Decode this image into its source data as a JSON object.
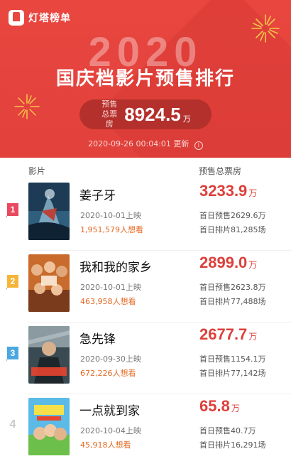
{
  "header": {
    "logo_text": "灯塔榜单",
    "year": "2020",
    "title": "国庆档影片预售排行",
    "presale_label": "预售 总票房",
    "presale_value": "8924.5",
    "presale_unit": "万",
    "update_text": "2020-09-26 00:04:01 更新",
    "info_icon": "i"
  },
  "columns": {
    "film": "影片",
    "presale": "预售总票房"
  },
  "colors": {
    "brand_red": "#e8463f",
    "gross_red": "#dd3f3a",
    "want_orange": "#e56a24",
    "rank1": "#e84a5f",
    "rank2": "#f4b63a",
    "rank3": "#4aa7e0"
  },
  "movies": [
    {
      "rank": "1",
      "title": "姜子牙",
      "release": "2020-10-01上映",
      "want": "1,951,579人想看",
      "gross": "3233.9",
      "gross_unit": "万",
      "first_day_presale": "首日预售2629.6万",
      "first_day_screenings": "首日排片81,285场"
    },
    {
      "rank": "2",
      "title": "我和我的家乡",
      "release": "2020-10-01上映",
      "want": "463,958人想看",
      "gross": "2899.0",
      "gross_unit": "万",
      "first_day_presale": "首日预售2623.8万",
      "first_day_screenings": "首日排片77,488场"
    },
    {
      "rank": "3",
      "title": "急先锋",
      "release": "2020-09-30上映",
      "want": "672,226人想看",
      "gross": "2677.7",
      "gross_unit": "万",
      "first_day_presale": "首日预售1154.1万",
      "first_day_screenings": "首日排片77,142场"
    },
    {
      "rank": "4",
      "title": "一点就到家",
      "release": "2020-10-04上映",
      "want": "45,918人想看",
      "gross": "65.8",
      "gross_unit": "万",
      "first_day_presale": "首日预售40.7万",
      "first_day_screenings": "首日排片16,291场"
    }
  ]
}
